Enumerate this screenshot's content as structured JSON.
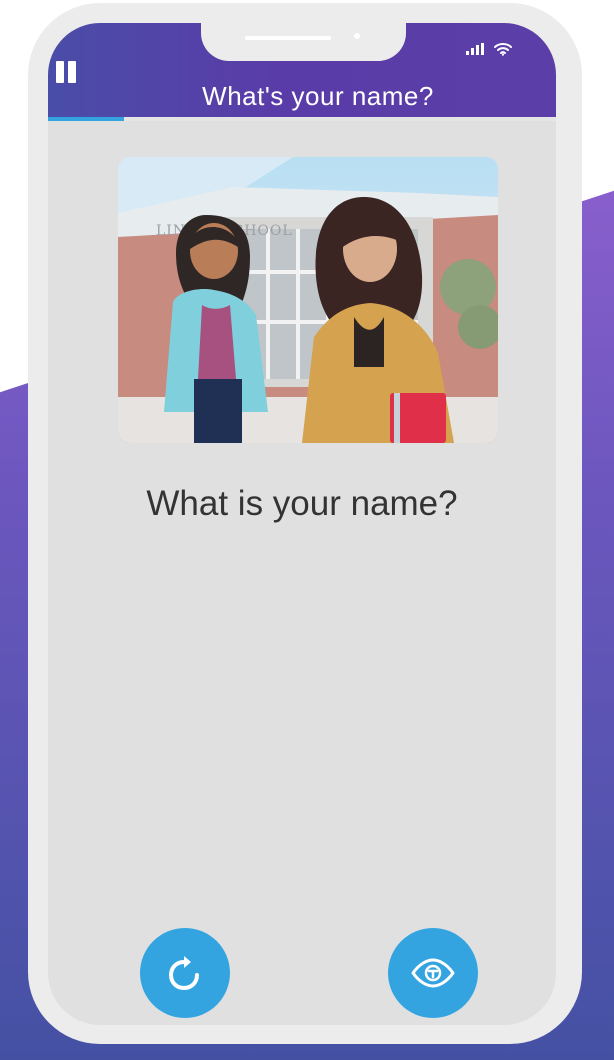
{
  "header": {
    "title": "What's your name?",
    "pause_icon": "pause-icon",
    "signal_icon": "signal-icon",
    "wifi_icon": "wifi-icon",
    "progress": 0.15
  },
  "scene": {
    "school_sign": "LINC   H SCHOOL"
  },
  "main": {
    "question_text": "What is your name?"
  },
  "actions": {
    "replay_icon": "replay-icon",
    "reveal_icon": "eye-icon"
  },
  "colors": {
    "header_start": "#4a4da8",
    "header_end": "#5c3ea8",
    "accent": "#34a4e1",
    "background_top": "#9b64d5",
    "background_bottom": "#4451a3"
  }
}
